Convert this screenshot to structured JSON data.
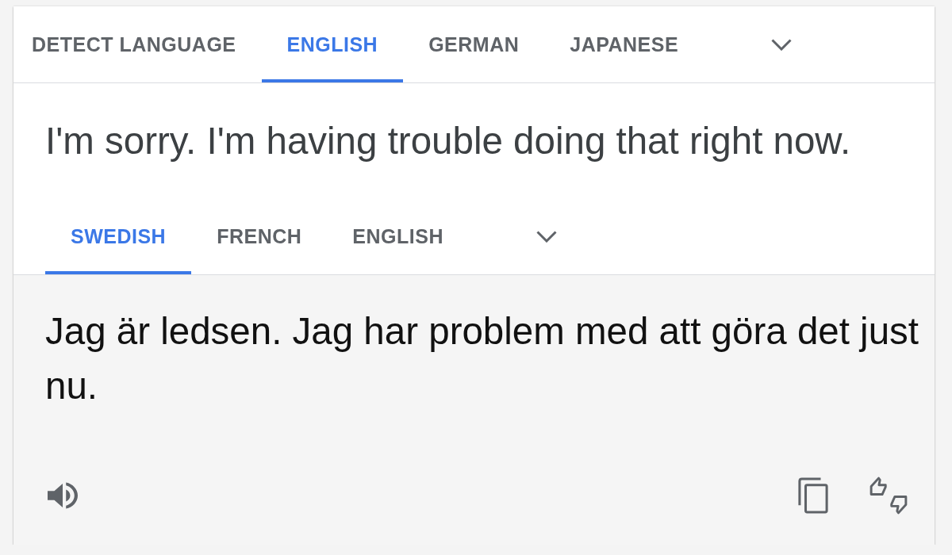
{
  "source_tabs": [
    {
      "label": "DETECT LANGUAGE",
      "selected": false
    },
    {
      "label": "ENGLISH",
      "selected": true
    },
    {
      "label": "GERMAN",
      "selected": false
    },
    {
      "label": "JAPANESE",
      "selected": false
    }
  ],
  "source_text": "I'm sorry. I'm having trouble doing that right now.",
  "target_tabs": [
    {
      "label": "SWEDISH",
      "selected": true
    },
    {
      "label": "FRENCH",
      "selected": false
    },
    {
      "label": "ENGLISH",
      "selected": false
    }
  ],
  "translation": "Jag är ledsen. Jag har problem med att göra det just nu."
}
